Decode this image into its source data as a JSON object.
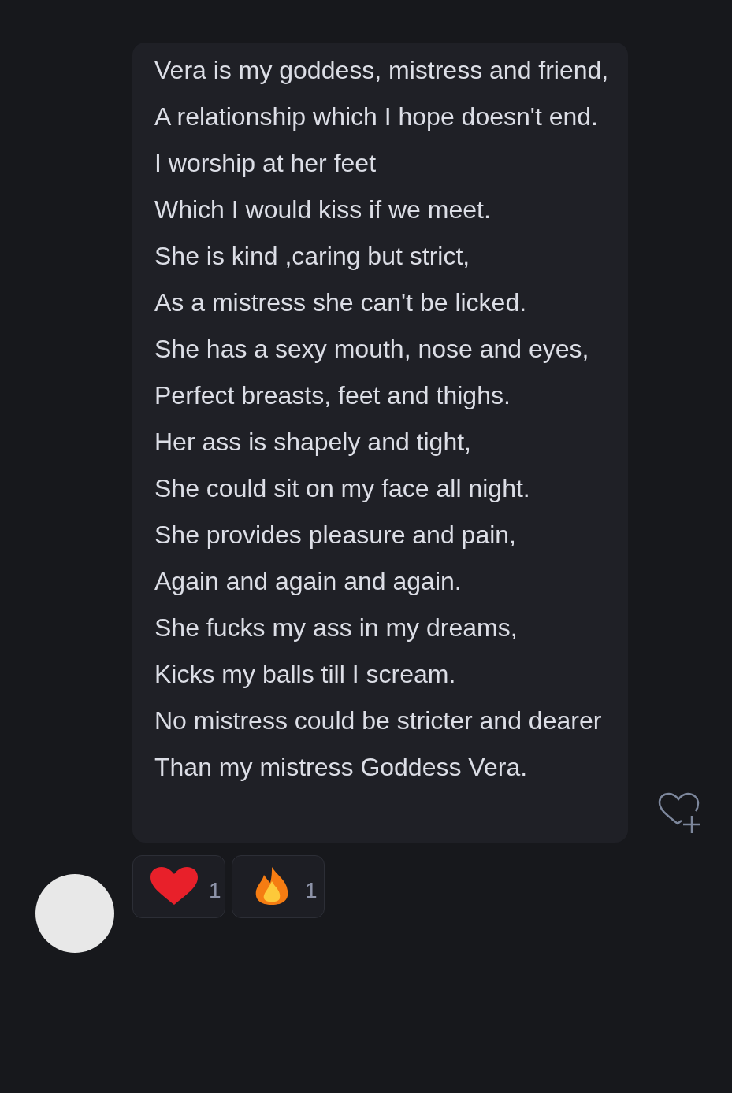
{
  "message": {
    "lines": [
      "Vera is my goddess, mistress and friend,",
      "A relationship which I hope doesn't end.",
      "I worship at her feet",
      "Which I would kiss if we meet.",
      "She is kind ,caring but strict,",
      "As a mistress she can't be licked.",
      "She has a sexy mouth, nose and eyes,",
      "Perfect breasts, feet and thighs.",
      "Her ass is shapely and tight,",
      "She could sit on my face all night.",
      "She provides pleasure and pain,",
      "Again and again and again.",
      "She fucks my ass in my dreams,",
      "Kicks my balls till I scream.",
      "No mistress could be stricter and dearer",
      "Than my mistress Goddess Vera."
    ]
  },
  "reactions": [
    {
      "kind": "heart",
      "count": "1"
    },
    {
      "kind": "fire",
      "count": "1"
    }
  ]
}
